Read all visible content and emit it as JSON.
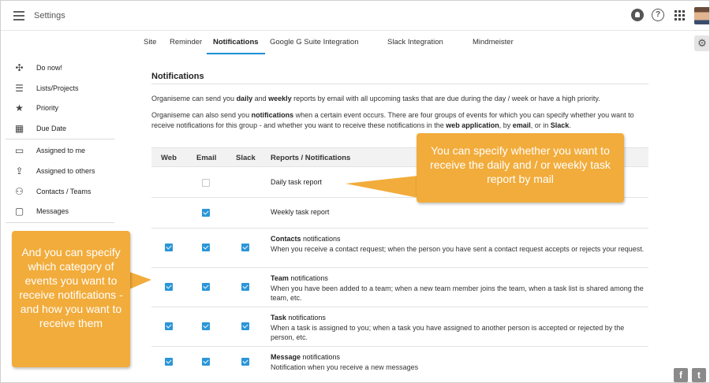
{
  "header": {
    "title": "Settings",
    "help_glyph": "?"
  },
  "tabs": [
    {
      "label": "Site"
    },
    {
      "label": "Reminder"
    },
    {
      "label": "Notifications",
      "active": true
    },
    {
      "label": "Google G Suite Integration"
    },
    {
      "label": "Slack Integration"
    },
    {
      "label": "Mindmeister"
    }
  ],
  "sidebar": {
    "items": [
      {
        "label": "Do now!",
        "icon": "gamepad-icon"
      },
      {
        "label": "Lists/Projects",
        "icon": "list-icon"
      },
      {
        "label": "Priority",
        "icon": "star-icon"
      },
      {
        "label": "Due Date",
        "icon": "calendar-icon"
      },
      {
        "label": "Assigned to me",
        "icon": "inbox-icon"
      },
      {
        "label": "Assigned to others",
        "icon": "outbox-icon"
      },
      {
        "label": "Contacts / Teams",
        "icon": "people-icon"
      },
      {
        "label": "Messages",
        "icon": "message-icon"
      }
    ]
  },
  "section": {
    "title": "Notifications",
    "para1": {
      "a": "Organiseme can send you ",
      "b1": "daily",
      "c": " and ",
      "b2": "weekly",
      "d": " reports by email with all upcoming tasks that are due during the day / week or have a high priority."
    },
    "para2": {
      "a": "Organiseme can also send you ",
      "b1": "notifications",
      "c": " when a certain event occurs. There are four groups of events for which you can specify whether you want to receive notifications for this group - and whether you want to receive these notifications in the ",
      "b2": "web application",
      "d": ", by ",
      "b3": "email",
      "e": ", or in ",
      "b4": "Slack",
      "f": "."
    }
  },
  "table": {
    "columns": [
      "Web",
      "Email",
      "Slack",
      "Reports / Notifications"
    ],
    "rows": [
      {
        "title_bold": "",
        "title": "Daily task report",
        "desc": "",
        "web": null,
        "email": false,
        "slack": null
      },
      {
        "title_bold": "",
        "title": "Weekly task report",
        "desc": "",
        "web": null,
        "email": true,
        "slack": null
      },
      {
        "title_bold": "Contacts",
        "title": " notifications",
        "desc": "When you receive a contact request; when the person you have sent a contact request accepts or rejects your request.",
        "web": true,
        "email": true,
        "slack": true
      },
      {
        "title_bold": "Team",
        "title": " notifications",
        "desc": "When you have been added to a team; when a new team member joins the team, when a task list is shared among the team, etc.",
        "web": true,
        "email": true,
        "slack": true
      },
      {
        "title_bold": "Task",
        "title": " notifications",
        "desc": "When a task is assigned to you; when a task you have assigned to another person is accepted or rejected by the person, etc.",
        "web": true,
        "email": true,
        "slack": true
      },
      {
        "title_bold": "Message",
        "title": " notifications",
        "desc": "Notification when you receive a new messages",
        "web": true,
        "email": true,
        "slack": true
      }
    ]
  },
  "callouts": {
    "right": "You can specify whether you want to receive the daily and / or weekly task report by mail",
    "left": "And you can specify which category of events you want to receive notifications - and how you want to receive them"
  },
  "social": {
    "facebook": "f",
    "twitter": "t"
  },
  "colors": {
    "accent": "#2b96d8",
    "callout": "#f2ac3b",
    "tab_underline": "#1a8fd6"
  }
}
